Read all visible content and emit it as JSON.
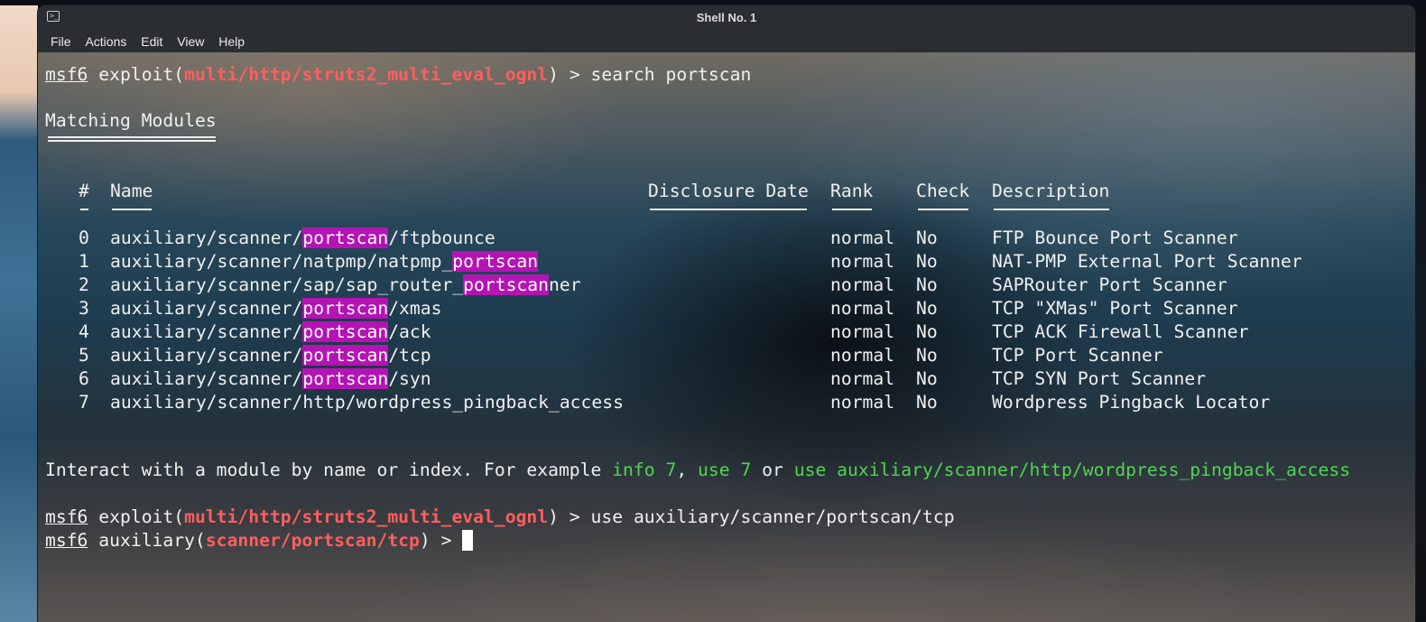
{
  "window": {
    "title": "Shell No. 1"
  },
  "menu": [
    "File",
    "Actions",
    "Edit",
    "View",
    "Help"
  ],
  "prompt": {
    "user": "msf6",
    "context_type": "exploit",
    "module": "multi/http/struts2_multi_eval_ognl",
    "arrow": " > ",
    "search_cmd": "search portscan",
    "use_cmd": "use auxiliary/scanner/portscan/tcp"
  },
  "results": {
    "heading": "Matching Modules",
    "headers": {
      "num": "#",
      "name": "Name",
      "date": "Disclosure Date",
      "rank": "Rank",
      "check": "Check",
      "desc": "Description"
    },
    "rows": [
      {
        "num": "0",
        "pre": "auxiliary/scanner/",
        "hl": "portscan",
        "post": "/ftpbounce",
        "rank": "normal",
        "check": "No",
        "desc": "FTP Bounce Port Scanner"
      },
      {
        "num": "1",
        "pre": "auxiliary/scanner/natpmp/natpmp_",
        "hl": "portscan",
        "post": "",
        "rank": "normal",
        "check": "No",
        "desc": "NAT-PMP External Port Scanner"
      },
      {
        "num": "2",
        "pre": "auxiliary/scanner/sap/sap_router_",
        "hl": "portscan",
        "post": "ner",
        "rank": "normal",
        "check": "No",
        "desc": "SAPRouter Port Scanner"
      },
      {
        "num": "3",
        "pre": "auxiliary/scanner/",
        "hl": "portscan",
        "post": "/xmas",
        "rank": "normal",
        "check": "No",
        "desc": "TCP \"XMas\" Port Scanner"
      },
      {
        "num": "4",
        "pre": "auxiliary/scanner/",
        "hl": "portscan",
        "post": "/ack",
        "rank": "normal",
        "check": "No",
        "desc": "TCP ACK Firewall Scanner"
      },
      {
        "num": "5",
        "pre": "auxiliary/scanner/",
        "hl": "portscan",
        "post": "/tcp",
        "rank": "normal",
        "check": "No",
        "desc": "TCP Port Scanner"
      },
      {
        "num": "6",
        "pre": "auxiliary/scanner/",
        "hl": "portscan",
        "post": "/syn",
        "rank": "normal",
        "check": "No",
        "desc": "TCP SYN Port Scanner"
      },
      {
        "num": "7",
        "pre": "auxiliary/scanner/http/wordpress_pingback_access",
        "hl": "",
        "post": "",
        "rank": "normal",
        "check": "No",
        "desc": "Wordpress Pingback Locator"
      }
    ]
  },
  "hint": {
    "lead": "Interact with a module by name or index. For example ",
    "ex1": "info 7",
    "sep1": ", ",
    "ex2": "use 7",
    "sep2": " or ",
    "ex3": "use auxiliary/scanner/http/wordpress_pingback_access"
  },
  "final_prompt": {
    "context_type": "auxiliary",
    "module": "scanner/portscan/tcp",
    "arrow": " > "
  },
  "colors": {
    "prompt_module": "#ff5f5f",
    "highlight": "#b414b4",
    "example_text": "#4fd64f",
    "titlebar": "#2a2d32"
  }
}
